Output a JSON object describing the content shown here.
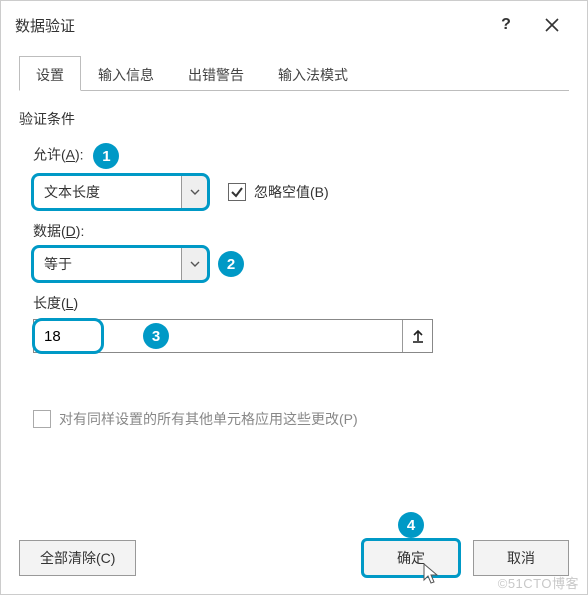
{
  "title": "数据验证",
  "titlebar": {
    "help_label": "?",
    "close_label": "×"
  },
  "tabs": [
    {
      "label": "设置",
      "active": true
    },
    {
      "label": "输入信息",
      "active": false
    },
    {
      "label": "出错警告",
      "active": false
    },
    {
      "label": "输入法模式",
      "active": false
    }
  ],
  "section_title": "验证条件",
  "allow": {
    "label": "允许(",
    "hotkey": "A",
    "label_suffix": "):",
    "value": "文本长度"
  },
  "ignore_blank": {
    "checked": true,
    "label": "忽略空值(",
    "hotkey": "B",
    "label_suffix": ")"
  },
  "data_op": {
    "label": "数据(",
    "hotkey": "D",
    "label_suffix": "):",
    "value": "等于"
  },
  "length": {
    "label": "长度(",
    "hotkey": "L",
    "label_suffix": ")",
    "value": "18"
  },
  "apply_all": {
    "checked": false,
    "label": "对有同样设置的所有其他单元格应用这些更改(P)"
  },
  "buttons": {
    "clear_all": "全部清除(",
    "clear_hotkey": "C",
    "clear_suffix": ")",
    "ok": "确定",
    "cancel": "取消"
  },
  "badges": {
    "b1": "1",
    "b2": "2",
    "b3": "3",
    "b4": "4"
  },
  "watermark": "©51CTO博客",
  "colors": {
    "accent": "#0099c6"
  }
}
